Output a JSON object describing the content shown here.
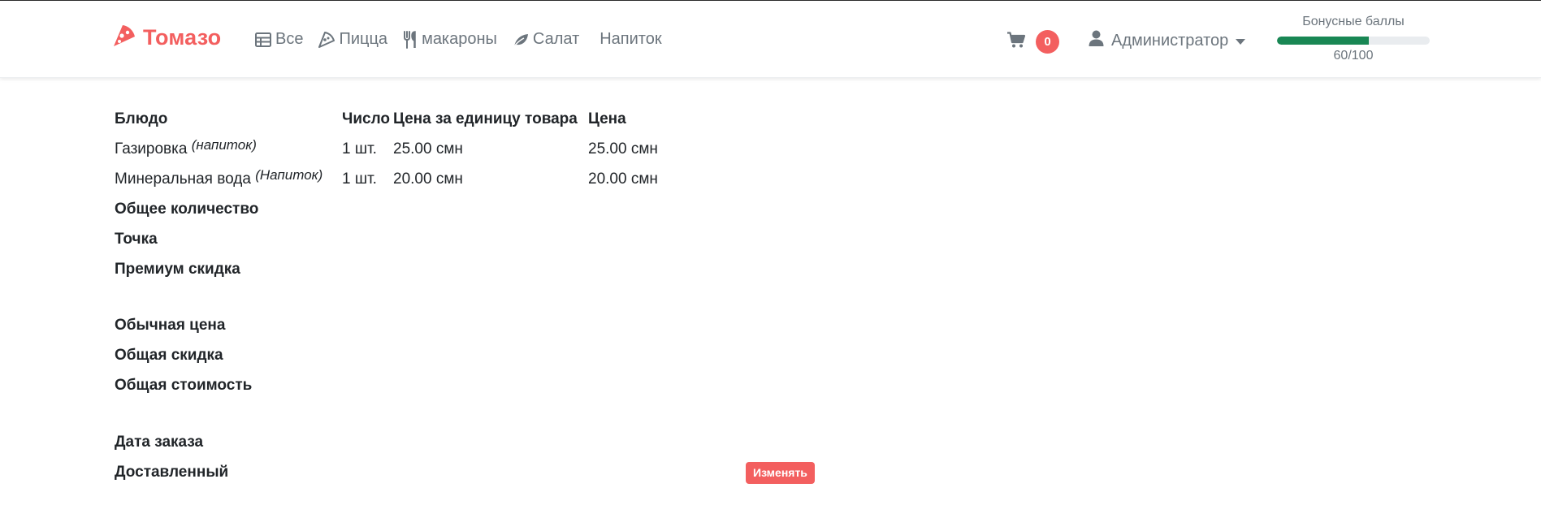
{
  "brand": {
    "name": "Томазо",
    "color": "#f35f5f",
    "icon": "pizza-icon"
  },
  "nav": {
    "items": [
      {
        "label": "Все",
        "icon": "table-icon"
      },
      {
        "label": "Пицца",
        "icon": "pizza-slice-icon"
      },
      {
        "label": "макароны",
        "icon": "utensils-icon"
      },
      {
        "label": "Салат",
        "icon": "leaf-icon"
      },
      {
        "label": "Напиток",
        "icon": ""
      }
    ]
  },
  "cart": {
    "icon": "cart-icon",
    "count": "0"
  },
  "user": {
    "name": "Администратор",
    "icon": "user-icon",
    "caret": "caret-down-icon"
  },
  "bonus": {
    "label": "Бонусные баллы",
    "value": "60/100",
    "progress": 0.6,
    "color": "#198754"
  },
  "order": {
    "headers": {
      "dish": "Блюдо",
      "qty": "Число",
      "unit_price": "Цена за единицу товара",
      "price": "Цена"
    },
    "items": [
      {
        "name": "Газировка",
        "category": "(напиток)",
        "qty": "1 шт.",
        "unit_price": "25.00 смн",
        "price": "25.00 смн"
      },
      {
        "name": "Минеральная вода",
        "category": "(Напиток)",
        "qty": "1 шт.",
        "unit_price": "20.00 смн",
        "price": "20.00 смн"
      }
    ],
    "summary": {
      "total_quantity": "Общее количество",
      "point": "Точка",
      "premium_discount": "Премиум скидка",
      "regular_price": "Обычная цена",
      "total_discount": "Общая скидка",
      "total_cost": "Общая стоимость",
      "order_date": "Дата заказа",
      "delivered": "Доставленный"
    },
    "change_button": "Изменять"
  }
}
